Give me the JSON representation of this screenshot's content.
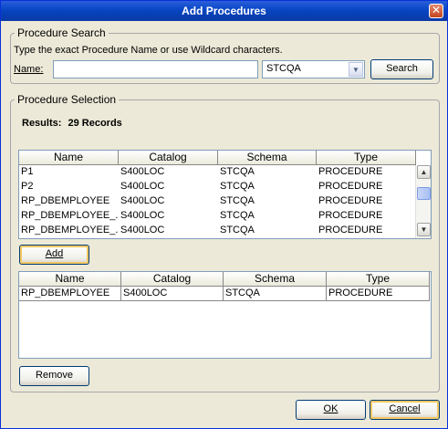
{
  "window": {
    "title": "Add Procedures",
    "close_glyph": "✕"
  },
  "search": {
    "legend": "Procedure Search",
    "hint": "Type the exact Procedure Name or use Wildcard characters.",
    "name_label": "Name:",
    "name_value": "",
    "schema_value": "STCQA",
    "search_button": "Search"
  },
  "selection": {
    "legend": "Procedure Selection",
    "results_label": "Results:",
    "results_value": "29 Records",
    "columns": [
      "Name",
      "Catalog",
      "Schema",
      "Type"
    ],
    "rows": [
      {
        "name": "P1",
        "catalog": "S400LOC",
        "schema": "STCQA",
        "type": "PROCEDURE"
      },
      {
        "name": "P2",
        "catalog": "S400LOC",
        "schema": "STCQA",
        "type": "PROCEDURE"
      },
      {
        "name": "RP_DBEMPLOYEE",
        "catalog": "S400LOC",
        "schema": "STCQA",
        "type": "PROCEDURE"
      },
      {
        "name": "RP_DBEMPLOYEE_...",
        "catalog": "S400LOC",
        "schema": "STCQA",
        "type": "PROCEDURE"
      },
      {
        "name": "RP_DBEMPLOYEE_...",
        "catalog": "S400LOC",
        "schema": "STCQA",
        "type": "PROCEDURE"
      }
    ],
    "add_button": "Add",
    "selected_columns": [
      "Name",
      "Catalog",
      "Schema",
      "Type"
    ],
    "selected_rows": [
      {
        "name": "RP_DBEMPLOYEE",
        "catalog": "S400LOC",
        "schema": "STCQA",
        "type": "PROCEDURE"
      }
    ],
    "remove_button": "Remove"
  },
  "footer": {
    "ok_button": "OK",
    "cancel_button": "Cancel"
  }
}
